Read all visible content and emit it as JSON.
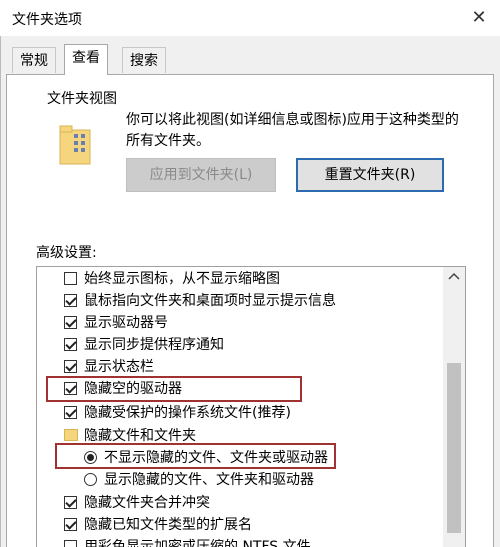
{
  "window": {
    "title": "文件夹选项",
    "close_glyph": "✕"
  },
  "tabs": [
    {
      "label": "常规",
      "active": false
    },
    {
      "label": "查看",
      "active": true
    },
    {
      "label": "搜索",
      "active": false
    }
  ],
  "folder_view": {
    "legend": "文件夹视图",
    "description": "你可以将此视图(如详细信息或图标)应用于这种类型的所有文件夹。",
    "apply_button": "应用到文件夹(L)",
    "reset_button": "重置文件夹(R)"
  },
  "advanced": {
    "label": "高级设置:",
    "items": [
      {
        "type": "checkbox",
        "checked": false,
        "label": "始终显示图标，从不显示缩略图"
      },
      {
        "type": "checkbox",
        "checked": true,
        "label": "鼠标指向文件夹和桌面项时显示提示信息"
      },
      {
        "type": "checkbox",
        "checked": true,
        "label": "显示驱动器号"
      },
      {
        "type": "checkbox",
        "checked": true,
        "label": "显示同步提供程序通知"
      },
      {
        "type": "checkbox",
        "checked": true,
        "label": "显示状态栏"
      },
      {
        "type": "checkbox",
        "checked": true,
        "label": "隐藏空的驱动器"
      },
      {
        "type": "checkbox",
        "checked": true,
        "label": "隐藏受保护的操作系统文件(推荐)"
      },
      {
        "type": "folder",
        "label": "隐藏文件和文件夹"
      },
      {
        "type": "radio",
        "selected": true,
        "label": "不显示隐藏的文件、文件夹或驱动器"
      },
      {
        "type": "radio",
        "selected": false,
        "label": "显示隐藏的文件、文件夹和驱动器"
      },
      {
        "type": "checkbox",
        "checked": true,
        "label": "隐藏文件夹合并冲突"
      },
      {
        "type": "checkbox",
        "checked": true,
        "label": "隐藏已知文件类型的扩展名"
      },
      {
        "type": "checkbox",
        "checked": false,
        "label": "用彩色显示加密或压缩的 NTFS 文件"
      }
    ]
  },
  "colors": {
    "highlight": "#a03232",
    "primary_button_border": "#2c6bb0",
    "folder": "#f5d57e"
  }
}
